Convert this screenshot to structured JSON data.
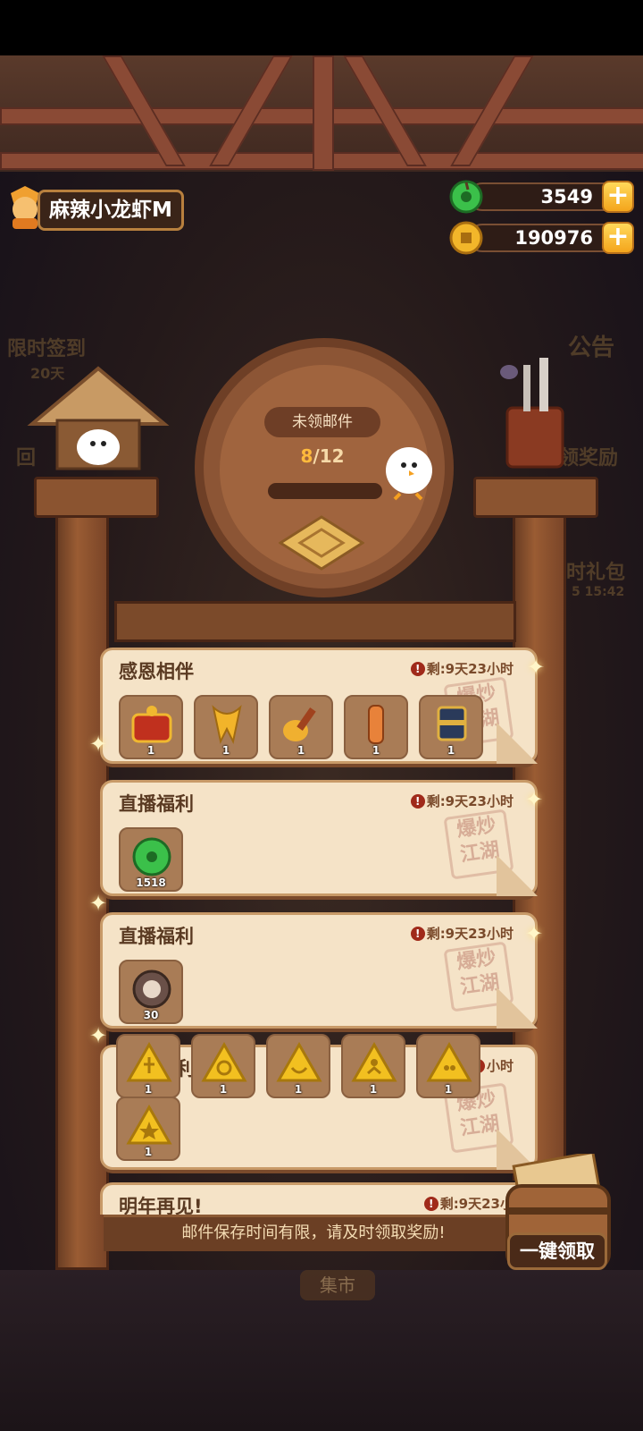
{
  "player": {
    "name": "麻辣小龙虾M"
  },
  "currency": [
    {
      "name": "jade",
      "value": "3549",
      "color": "#3bc04a"
    },
    {
      "name": "coin",
      "value": "190976",
      "color": "#f2b62a"
    }
  ],
  "side_labels": {
    "left_top": "限时签到",
    "left_days": "20天",
    "left_mid": "回",
    "right_top": "公告",
    "right_mid": "领奖励",
    "right_low": "时礼包",
    "right_timer": "5 15:42"
  },
  "mailbox": {
    "unread_label": "未领邮件",
    "unread_current": "8",
    "unread_total": "/12"
  },
  "stamp_text": "爆炒\n江湖",
  "mails": [
    {
      "title": "感恩相伴",
      "time": "剩:9天23小时",
      "items": [
        {
          "icon": "red-treasure-chest-icon",
          "qty": "1"
        },
        {
          "icon": "gold-scarf-icon",
          "qty": "1"
        },
        {
          "icon": "gold-spoon-icon",
          "qty": "1"
        },
        {
          "icon": "orange-scroll-icon",
          "qty": "1"
        },
        {
          "icon": "striped-hat-icon",
          "qty": "1"
        }
      ]
    },
    {
      "title": "直播福利",
      "time": "剩:9天23小时",
      "items": [
        {
          "icon": "jade-coin-icon",
          "qty": "1518"
        }
      ]
    },
    {
      "title": "直播福利",
      "time": "剩:9天23小时",
      "items": [
        {
          "icon": "stone-wheel-icon",
          "qty": "30"
        }
      ]
    },
    {
      "title": "利",
      "time": "小时",
      "items": [
        {
          "icon": "yellow-rune-flame-icon",
          "qty": "1"
        },
        {
          "icon": "yellow-rune-spiral-icon",
          "qty": "1"
        },
        {
          "icon": "yellow-rune-bowl-icon",
          "qty": "1"
        },
        {
          "icon": "yellow-rune-figure-icon",
          "qty": "1"
        },
        {
          "icon": "yellow-rune-dot-icon",
          "qty": "1"
        },
        {
          "icon": "yellow-rune-star-icon",
          "qty": "1"
        }
      ]
    },
    {
      "title": "明年再见!",
      "time": "剩:9天23小",
      "items": []
    }
  ],
  "footer_text": "邮件保存时间有限，请及时领取奖励!",
  "collect_all": "一键领取",
  "bottom_label": "集市"
}
